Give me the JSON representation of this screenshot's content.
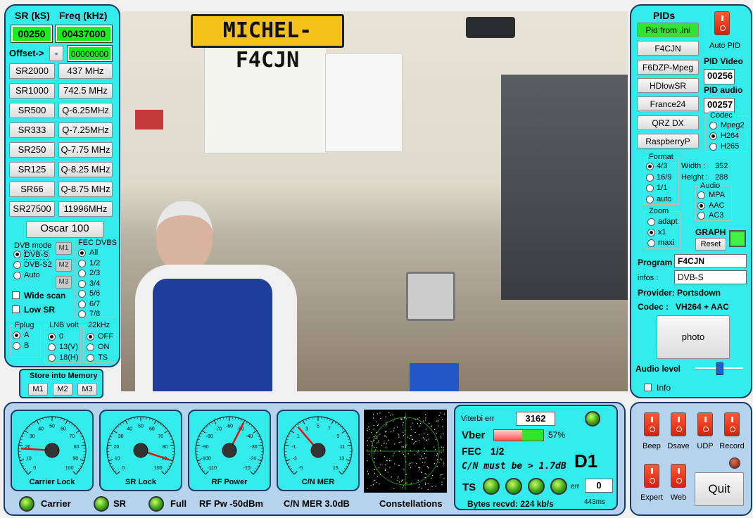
{
  "left_panel": {
    "sr_label": "SR (kS)",
    "freq_label": "Freq (kHz)",
    "sr_value": "00250",
    "freq_value": "00437000",
    "offset_label": "Offset->",
    "offset_sign": "-",
    "offset_value": "00000000",
    "sr_buttons": [
      "SR2000",
      "SR1000",
      "SR500",
      "SR333",
      "SR250",
      "SR125",
      "SR66",
      "SR27500"
    ],
    "freq_buttons": [
      "437 MHz",
      "742.5 MHz",
      "Q-6.25MHz",
      "Q-7.25MHz",
      "Q-7.75 MHz",
      "Q-8.25 MHz",
      "Q-8.75 MHz",
      "11996MHz"
    ],
    "preset_button": "Oscar 100",
    "dvb_mode_title": "DVB mode",
    "dvb_modes": [
      "DVB-S",
      "DVB-S2",
      "Auto"
    ],
    "memory_buttons": [
      "M1",
      "M2",
      "M3"
    ],
    "fec_title": "FEC DVBS",
    "fec_options": [
      "All",
      "1/2",
      "2/3",
      "3/4",
      "5/6",
      "6/7",
      "7/8"
    ],
    "wide_scan": "Wide scan",
    "low_sr": "Low SR",
    "fplug_title": "Fplug",
    "fplug_options": [
      "A",
      "B"
    ],
    "lnb_title": "LNB volt",
    "lnb_options": [
      "0",
      "13(V)",
      "18(H)"
    ],
    "khz_title": "22kHz",
    "khz_options": [
      "OFF",
      "ON",
      "TS"
    ],
    "store_title": "Store into Memory",
    "store_buttons": [
      "M1",
      "M2",
      "M3"
    ]
  },
  "video": {
    "plate_text": "MICHEL-F4CJN"
  },
  "right_panel": {
    "pids_title": "PIDs",
    "pid_buttons": [
      "Pid from .ini",
      "F4CJN",
      "F6DZP-Mpeg",
      "HDlowSR",
      "France24",
      "QRZ DX",
      "RaspberryP"
    ],
    "auto_pid": "Auto PID",
    "pid_video_label": "PID Video",
    "pid_video_value": "00256",
    "pid_audio_label": "PID audio",
    "pid_audio_value": "00257",
    "codec_title": "Codec",
    "codec_options": [
      "Mpeg2",
      "H264",
      "H265"
    ],
    "format_title": "Format",
    "format_options": [
      "4/3",
      "16/9",
      "1/1",
      "auto"
    ],
    "width_label": "Width :",
    "width_value": "352",
    "height_label": "Height :",
    "height_value": "288",
    "audio_title": "Audio",
    "audio_options": [
      "MPA",
      "AAC",
      "AC3"
    ],
    "zoom_title": "Zoom",
    "zoom_options": [
      "adapt",
      "x1",
      "maxi"
    ],
    "graph_label": "GRAPH",
    "reset_button": "Reset",
    "program_label": "Program",
    "program_value": "F4CJN",
    "infos_label": "infos :",
    "infos_value": "DVB-S",
    "provider_text": "Provider: Portsdown",
    "codec_text_label": "Codec :",
    "codec_text_value": "VH264 + AAC",
    "photo_button": "photo",
    "audio_level_label": "Audio level",
    "audio_level_fraction": 0.5,
    "info_checkbox": "Info"
  },
  "bottom": {
    "gauges": [
      {
        "name": "Carrier Lock",
        "ticks": [
          "0",
          "10",
          "20",
          "30",
          "40",
          "50",
          "60",
          "70",
          "80",
          "90",
          "100"
        ],
        "needle": 0.18
      },
      {
        "name": "SR Lock",
        "ticks": [
          "0",
          "10",
          "20",
          "30",
          "40",
          "50",
          "60",
          "70",
          "80",
          "90",
          "100"
        ],
        "needle": 0.9
      },
      {
        "name": "RF Power",
        "ticks": [
          "-110",
          "-100",
          "-90",
          "-80",
          "-70",
          "-60",
          "-50",
          "-40",
          "-30",
          "-20",
          "-10"
        ],
        "needle": 0.6
      },
      {
        "name": "C/N MER",
        "ticks": [
          "-5",
          "-3",
          "-1",
          "1",
          "3",
          "5",
          "7",
          "9",
          "11",
          "13",
          "15"
        ],
        "needle": 0.35
      }
    ],
    "status_carrier": "Carrier",
    "status_sr": "SR",
    "status_full": "Full",
    "rf_pw_text": "RF Pw -50dBm",
    "cn_mer_text": "C/N MER 3.0dB",
    "constellations_label": "Constellations",
    "viterbi_label": "Viterbi err",
    "viterbi_value": "3162",
    "vber_label": "Vber",
    "vber_percent": 57,
    "vber_text": "57%",
    "fec_label": "FEC",
    "fec_value": "1/2",
    "cn_must_text": "C/N must be > 1.7dB",
    "mode_code": "D1",
    "ts_label": "TS",
    "err_label": "err",
    "err_value": "0",
    "bytes_text": "Bytes recvd:  224 kb/s",
    "latency_text": "443ms"
  },
  "controls": {
    "toggles": [
      "Beep",
      "Dsave",
      "UDP",
      "Record",
      "Expert",
      "Web"
    ],
    "quit_button": "Quit"
  }
}
